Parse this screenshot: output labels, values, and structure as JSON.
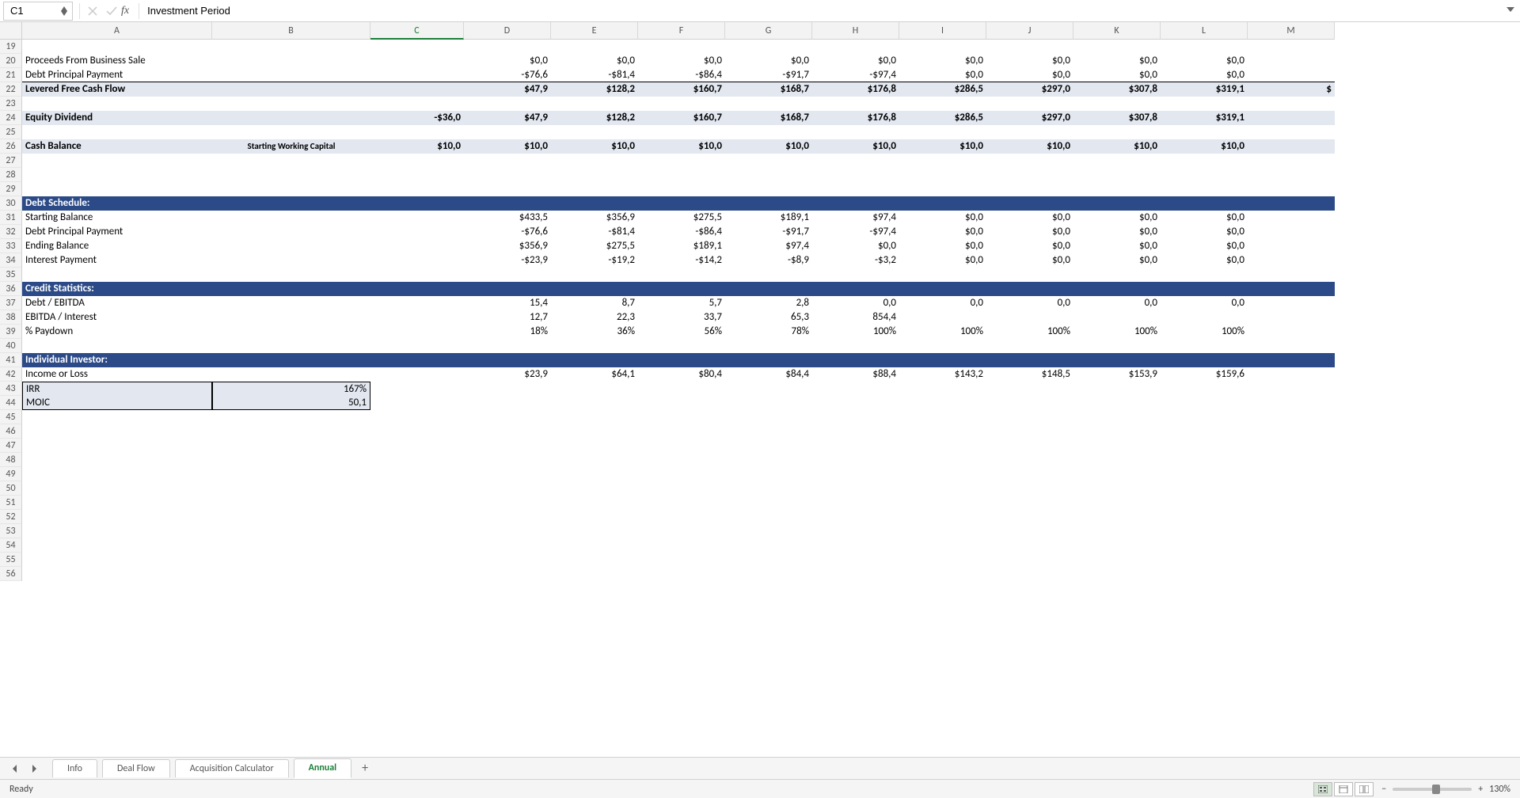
{
  "nameBox": "C1",
  "formula": "Investment Period",
  "columns": [
    "A",
    "B",
    "C",
    "D",
    "E",
    "F",
    "G",
    "H",
    "I",
    "J",
    "K",
    "L",
    "M"
  ],
  "activeCol": "C",
  "startRow": 19,
  "endRow": 56,
  "rows": {
    "20": {
      "label": "Proceeds From Business Sale",
      "vals": [
        "$0,0",
        "$0,0",
        "$0,0",
        "$0,0",
        "$0,0",
        "$0,0",
        "$0,0",
        "$0,0",
        "$0,0"
      ]
    },
    "21": {
      "label": "Debt Principal Payment",
      "vals": [
        "-$76,6",
        "-$81,4",
        "-$86,4",
        "-$91,7",
        "-$97,4",
        "$0,0",
        "$0,0",
        "$0,0",
        "$0,0"
      ],
      "underline": true
    },
    "22": {
      "label": "Levered Free Cash Flow",
      "bold": true,
      "shade": true,
      "vals": [
        "$47,9",
        "$128,2",
        "$160,7",
        "$168,7",
        "$176,8",
        "$286,5",
        "$297,0",
        "$307,8",
        "$319,1"
      ],
      "extra": "$"
    },
    "24": {
      "label": "Equity Dividend",
      "bold": true,
      "shade": true,
      "c": "-$36,0",
      "vals": [
        "$47,9",
        "$128,2",
        "$160,7",
        "$168,7",
        "$176,8",
        "$286,5",
        "$297,0",
        "$307,8",
        "$319,1"
      ]
    },
    "26": {
      "label": "Cash Balance",
      "bold": true,
      "shade": true,
      "b": "Starting Working Capital",
      "bsmall": true,
      "c": "$10,0",
      "vals": [
        "$10,0",
        "$10,0",
        "$10,0",
        "$10,0",
        "$10,0",
        "$10,0",
        "$10,0",
        "$10,0",
        "$10,0"
      ]
    },
    "30": {
      "sec": "Debt Schedule:"
    },
    "31": {
      "label": "Starting Balance",
      "vals": [
        "$433,5",
        "$356,9",
        "$275,5",
        "$189,1",
        "$97,4",
        "$0,0",
        "$0,0",
        "$0,0",
        "$0,0"
      ]
    },
    "32": {
      "label": "Debt Principal Payment",
      "vals": [
        "-$76,6",
        "-$81,4",
        "-$86,4",
        "-$91,7",
        "-$97,4",
        "$0,0",
        "$0,0",
        "$0,0",
        "$0,0"
      ]
    },
    "33": {
      "label": "Ending Balance",
      "vals": [
        "$356,9",
        "$275,5",
        "$189,1",
        "$97,4",
        "$0,0",
        "$0,0",
        "$0,0",
        "$0,0",
        "$0,0"
      ]
    },
    "34": {
      "label": "Interest Payment",
      "vals": [
        "-$23,9",
        "-$19,2",
        "-$14,2",
        "-$8,9",
        "-$3,2",
        "$0,0",
        "$0,0",
        "$0,0",
        "$0,0"
      ]
    },
    "36": {
      "sec": "Credit Statistics:"
    },
    "37": {
      "label": "Debt / EBITDA",
      "vals": [
        "15,4",
        "8,7",
        "5,7",
        "2,8",
        "0,0",
        "0,0",
        "0,0",
        "0,0",
        "0,0"
      ]
    },
    "38": {
      "label": "EBITDA / Interest",
      "vals": [
        "12,7",
        "22,3",
        "33,7",
        "65,3",
        "854,4",
        "",
        "",
        "",
        ""
      ]
    },
    "39": {
      "label": "% Paydown",
      "vals": [
        "18%",
        "36%",
        "56%",
        "78%",
        "100%",
        "100%",
        "100%",
        "100%",
        "100%"
      ]
    },
    "41": {
      "sec": "Individual Investor:"
    },
    "42": {
      "label": "Income or Loss",
      "vals": [
        "$23,9",
        "$64,1",
        "$80,4",
        "$84,4",
        "$88,4",
        "$143,2",
        "$148,5",
        "$153,9",
        "$159,6"
      ]
    },
    "43": {
      "label": "IRR",
      "inv": "top",
      "b": "167%"
    },
    "44": {
      "label": "MOIC",
      "inv": "bot",
      "b": "50,1"
    }
  },
  "tabs": [
    "Info",
    "Deal Flow",
    "Acquisition Calculator",
    "Annual"
  ],
  "activeTab": "Annual",
  "status": "Ready",
  "zoom": "130%"
}
